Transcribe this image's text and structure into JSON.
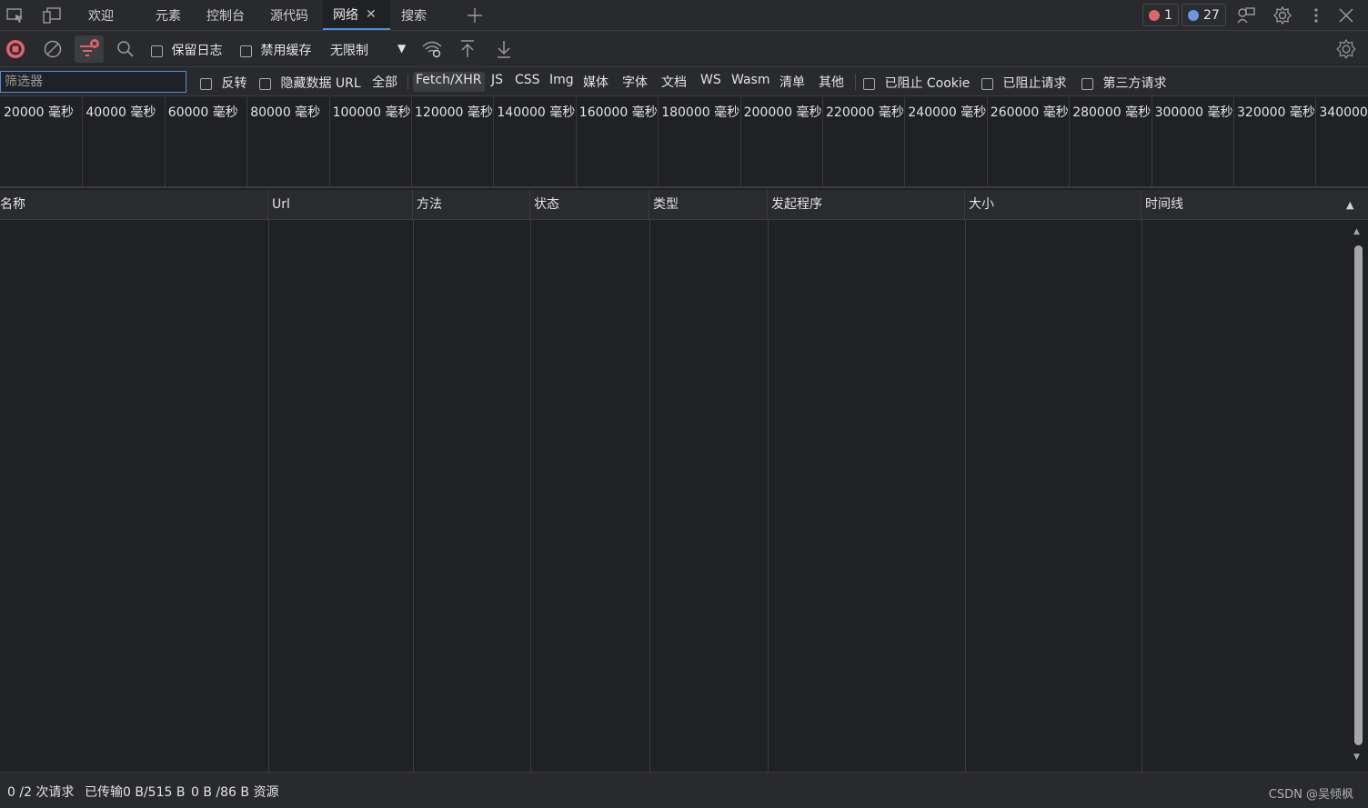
{
  "tabs": [
    {
      "label": "欢迎"
    },
    {
      "label": "元素"
    },
    {
      "label": "控制台"
    },
    {
      "label": "源代码"
    },
    {
      "label": "网络"
    },
    {
      "label": "搜索"
    }
  ],
  "badges": {
    "errors": "1",
    "messages": "27"
  },
  "toolbar": {
    "preserve_log": "保留日志",
    "disable_cache": "禁用缓存",
    "throttling": "无限制"
  },
  "filter": {
    "placeholder": "筛选器",
    "invert": "反转",
    "hide_data_urls": "隐藏数据 URL",
    "types": [
      "全部",
      "Fetch/XHR",
      "JS",
      "CSS",
      "Img",
      "媒体",
      "字体",
      "文档",
      "WS",
      "Wasm",
      "清单",
      "其他"
    ],
    "selected_type": "Fetch/XHR",
    "blocked_cookies": "已阻止 Cookie",
    "blocked_requests": "已阻止请求",
    "third_party": "第三方请求"
  },
  "overview": {
    "labels": [
      "20000 毫秒",
      "40000 毫秒",
      "60000 毫秒",
      "80000 毫秒",
      "100000 毫秒",
      "120000 毫秒",
      "140000 毫秒",
      "160000 毫秒",
      "180000 毫秒",
      "200000 毫秒",
      "220000 毫秒",
      "240000 毫秒",
      "260000 毫秒",
      "280000 毫秒",
      "300000 毫秒",
      "320000 毫秒",
      "340000 毫秒"
    ]
  },
  "table": {
    "columns": [
      "名称",
      "Url",
      "方法",
      "状态",
      "类型",
      "发起程序",
      "大小",
      "时间线"
    ]
  },
  "status": {
    "requests": "0 /2 次请求",
    "transferred": "已传输0 B/515 B",
    "resources": "0 B /86 B 资源",
    "watermark": "CSDN @吴倾枫"
  },
  "colors": {
    "accent": "#4a90e2",
    "error": "#e0646a",
    "record": "#e0646a"
  }
}
